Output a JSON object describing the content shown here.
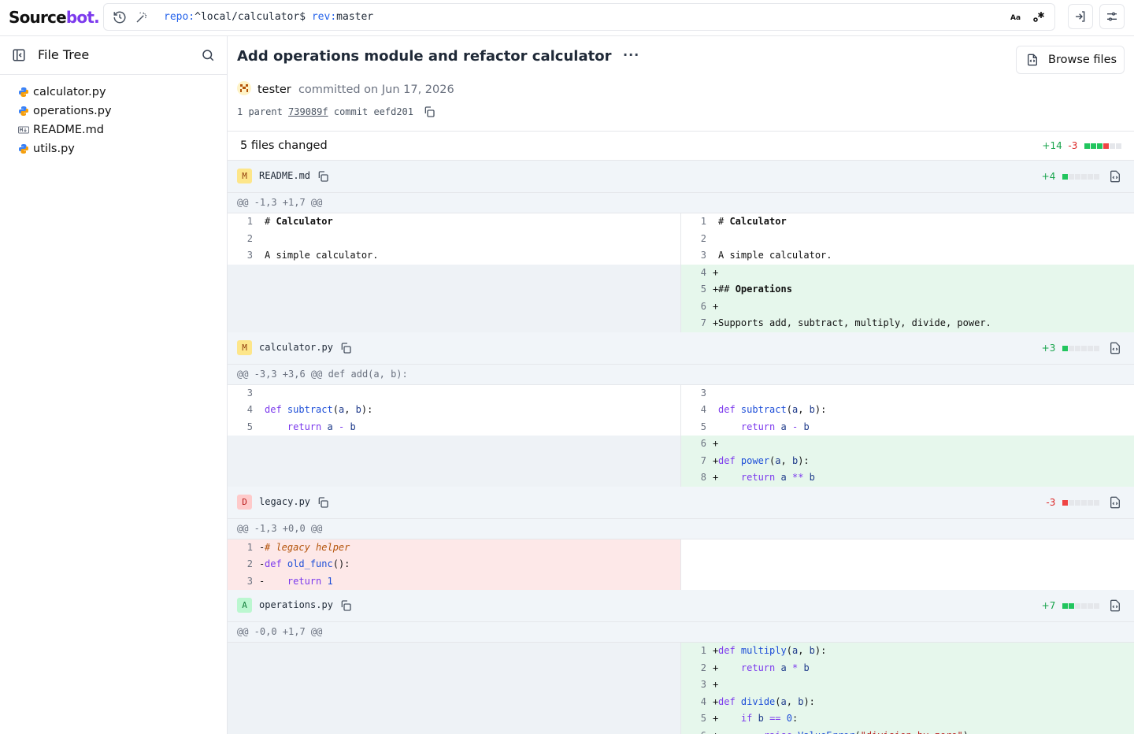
{
  "brand": {
    "part1": "Source",
    "part2": "bot."
  },
  "search": {
    "key1": "repo:",
    "val1": "^local/calculator$ ",
    "key2": "rev:",
    "val2": "master"
  },
  "sidebar": {
    "title": "File Tree",
    "files": [
      {
        "name": "calculator.py",
        "icon": "python-icon"
      },
      {
        "name": "operations.py",
        "icon": "python-icon"
      },
      {
        "name": "README.md",
        "icon": "markdown-icon"
      },
      {
        "name": "utils.py",
        "icon": "python-icon"
      }
    ]
  },
  "commit": {
    "title": "Add operations module and refactor calculator",
    "more": "···",
    "browse_label": "Browse files",
    "author": "tester",
    "committed_text": "committed on Jun 17, 2026",
    "parent_prefix": "1 parent",
    "parent_hash": "739089f",
    "commit_prefix": "commit",
    "commit_hash": "eefd201"
  },
  "summary": {
    "files_changed": "5 files changed",
    "additions": "+14",
    "deletions": "-3"
  },
  "files": [
    {
      "status": "M",
      "name": "README.md",
      "stat": "+4",
      "hunk": "@@ -1,3 +1,7 @@"
    },
    {
      "status": "M",
      "name": "calculator.py",
      "stat": "+3",
      "hunk": "@@ -3,3 +3,6 @@ def add(a, b):"
    },
    {
      "status": "D",
      "name": "legacy.py",
      "stat": "-3",
      "hunk": "@@ -1,3 +0,0 @@"
    },
    {
      "status": "A",
      "name": "operations.py",
      "stat": "+7",
      "hunk": "@@ -0,0 +1,7 @@"
    }
  ],
  "colors": {
    "accent": "#7c3aed",
    "added": "#22c55e",
    "deleted": "#ef4444"
  }
}
